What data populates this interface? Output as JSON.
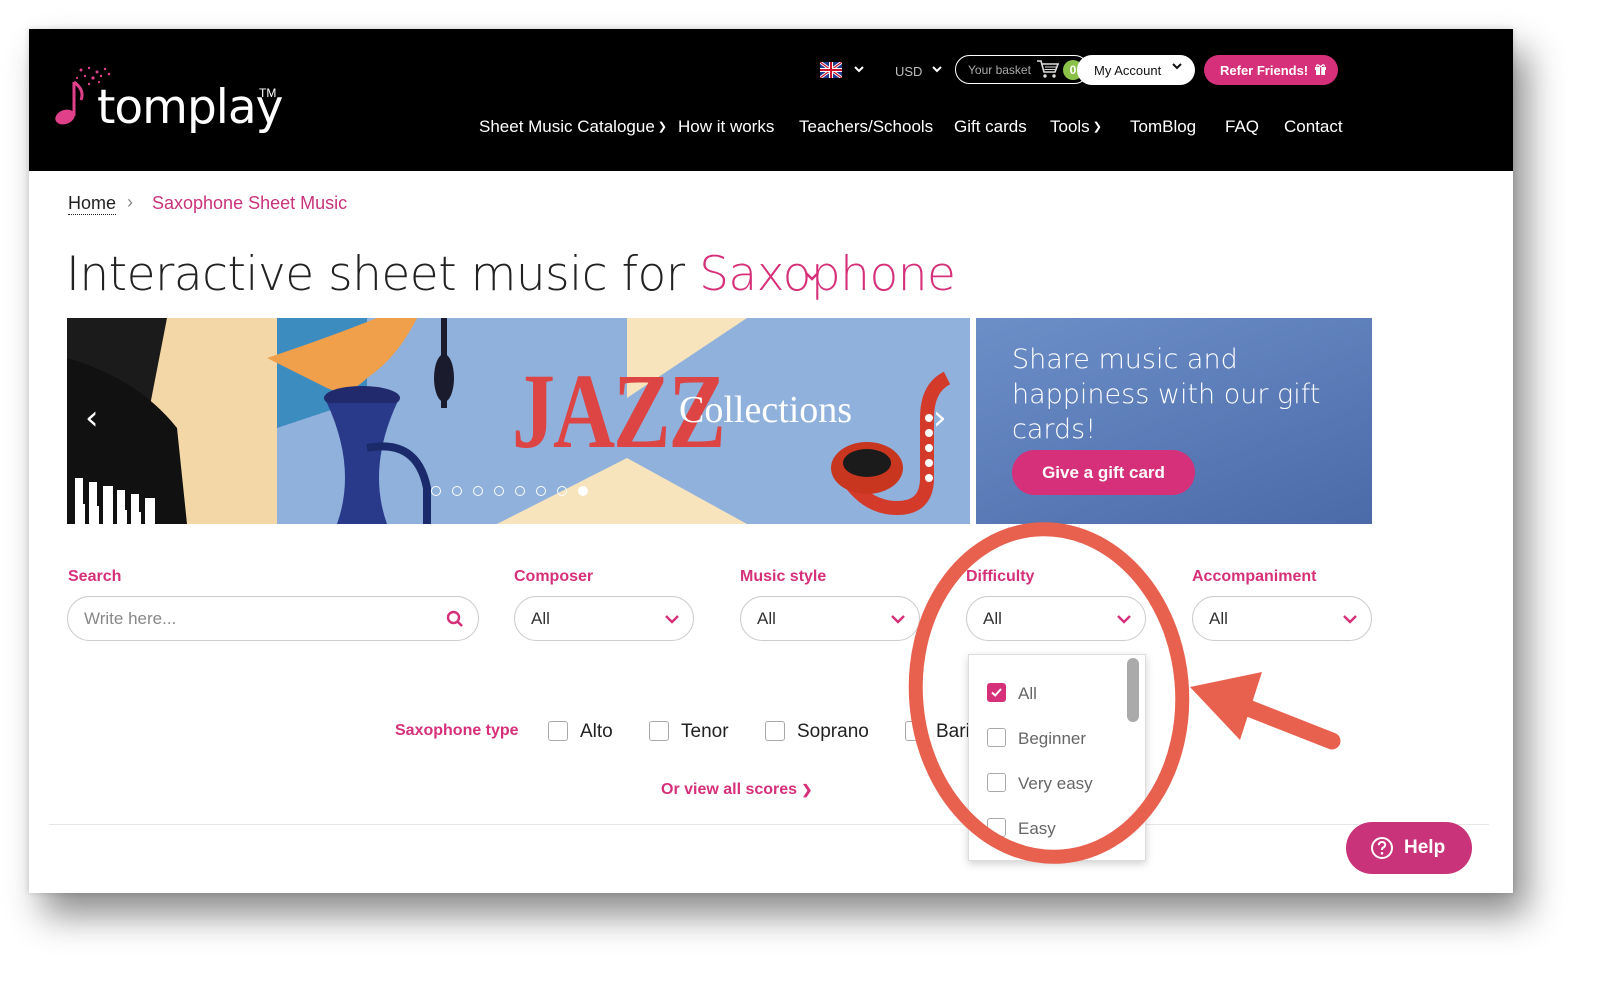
{
  "header": {
    "logo_text": "tomplay",
    "logo_tm": "TM",
    "currency": "USD",
    "basket_label": "Your basket",
    "basket_count": "0",
    "account_label": "My Account",
    "refer_label": "Refer Friends!",
    "nav": {
      "catalogue": "Sheet Music Catalogue",
      "how": "How it works",
      "teachers": "Teachers/Schools",
      "gift": "Gift cards",
      "tools": "Tools",
      "blog": "TomBlog",
      "faq": "FAQ",
      "contact": "Contact"
    }
  },
  "breadcrumb": {
    "home": "Home",
    "current": "Saxophone Sheet Music"
  },
  "title": {
    "prefix": "Interactive sheet music for",
    "instrument": "Saxophone"
  },
  "banner": {
    "jazz": "JAZZ",
    "collections": "Collections",
    "slide_count": 8,
    "active_slide": 8
  },
  "giftcard": {
    "text": "Share music and happiness with our gift cards!",
    "button": "Give a gift card"
  },
  "filters": {
    "search": {
      "label": "Search",
      "placeholder": "Write here..."
    },
    "composer": {
      "label": "Composer",
      "value": "All"
    },
    "style": {
      "label": "Music style",
      "value": "All"
    },
    "difficulty": {
      "label": "Difficulty",
      "value": "All"
    },
    "accompaniment": {
      "label": "Accompaniment",
      "value": "All"
    }
  },
  "saxophone_type": {
    "label": "Saxophone type",
    "options": [
      "Alto",
      "Tenor",
      "Soprano",
      "Bari"
    ]
  },
  "difficulty_dropdown": {
    "options": [
      {
        "label": "All",
        "checked": true
      },
      {
        "label": "Beginner",
        "checked": false
      },
      {
        "label": "Very easy",
        "checked": false
      },
      {
        "label": "Easy",
        "checked": false
      }
    ]
  },
  "view_all": "Or view all scores",
  "help": "Help",
  "colors": {
    "brand_pink": "#d6307a",
    "annotation": "#e8614f",
    "header_bg": "#000000"
  }
}
